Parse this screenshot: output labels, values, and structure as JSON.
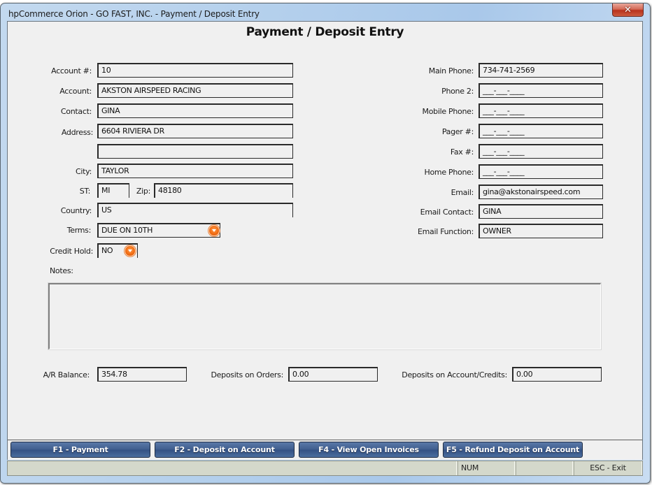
{
  "window": {
    "title": "hpCommerce Orion - GO FAST, INC. - Payment / Deposit Entry",
    "close_label": "✕"
  },
  "form": {
    "title": "Payment / Deposit Entry"
  },
  "left_fields": {
    "account_no": {
      "label": "Account #:",
      "value": "10"
    },
    "account": {
      "label": "Account:",
      "value": "AKSTON AIRSPEED RACING"
    },
    "contact": {
      "label": "Contact:",
      "value": "GINA"
    },
    "address": {
      "label": "Address:",
      "value": "6604 RIVIERA DR"
    },
    "address2": {
      "value": ""
    },
    "city": {
      "label": "City:",
      "value": "TAYLOR"
    },
    "state": {
      "label": "ST:",
      "value": "MI"
    },
    "zip": {
      "label": "Zip:",
      "value": "48180"
    },
    "country": {
      "label": "Country:",
      "value": "US"
    },
    "terms": {
      "label": "Terms:",
      "value": "DUE ON 10TH"
    },
    "credit_hold": {
      "label": "Credit Hold:",
      "value": "NO"
    },
    "notes": {
      "label": "Notes:",
      "value": ""
    }
  },
  "right_fields": {
    "main_phone": {
      "label": "Main Phone:",
      "value": "734-741-2569"
    },
    "phone2": {
      "label": "Phone 2:",
      "value": "___-___-____"
    },
    "mobile_phone": {
      "label": "Mobile Phone:",
      "value": "___-___-____"
    },
    "pager": {
      "label": "Pager #:",
      "value": "___-___-____"
    },
    "fax": {
      "label": "Fax #:",
      "value": "___-___-____"
    },
    "home_phone": {
      "label": "Home Phone:",
      "value": "___-___-____"
    },
    "email": {
      "label": "Email:",
      "value": "gina@akstonairspeed.com"
    },
    "email_contact": {
      "label": "Email Contact:",
      "value": "GINA"
    },
    "email_function": {
      "label": "Email Function:",
      "value": "OWNER"
    }
  },
  "balances": {
    "ar_balance": {
      "label": "A/R Balance:",
      "value": "354.78"
    },
    "deposits_on_orders": {
      "label": "Deposits on Orders:",
      "value": "0.00"
    },
    "deposits_on_account": {
      "label": "Deposits on Account/Credits:",
      "value": "0.00"
    }
  },
  "buttons": [
    {
      "label": "F1 - Payment"
    },
    {
      "label": "F2 - Deposit on Account"
    },
    {
      "label": "F4 - View Open Invoices"
    },
    {
      "label": "F5 - Refund Deposit on Account"
    }
  ],
  "statusbar": {
    "main": "",
    "num": "NUM",
    "blank": "",
    "exit": "ESC - Exit"
  },
  "icons": {
    "dropdown": "chevron-down-circle-icon",
    "close": "close-icon"
  },
  "colors": {
    "button_blue": "#3f5d8e",
    "dropdown_orange": "#f06a10",
    "close_red": "#c6402a",
    "client_bg": "#f0f0f0",
    "statusbar_bg": "#d4d8cb"
  }
}
